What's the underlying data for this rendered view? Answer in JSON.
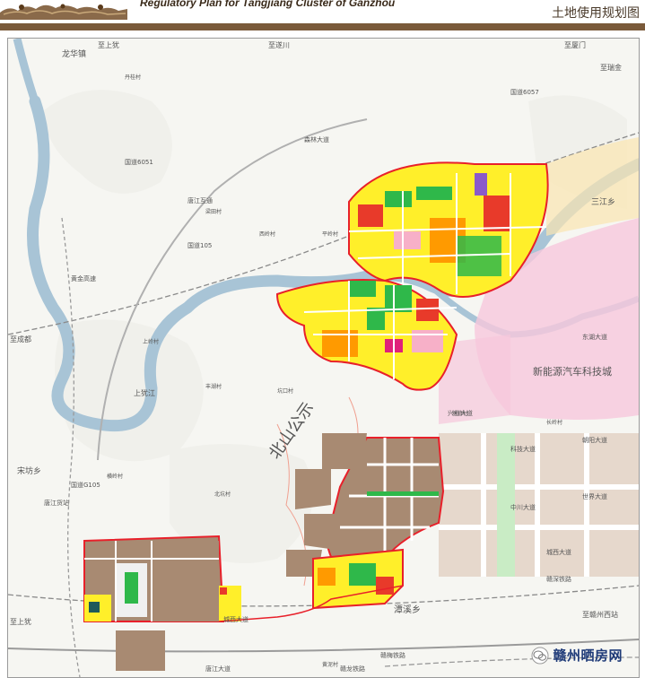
{
  "header": {
    "title_en": "Regulatory Plan for Tangjiang Cluster of Ganzhou",
    "title_cn": "土地使用规划图"
  },
  "colors": {
    "header_band": "#7a5a3a",
    "plan_boundary": "#e8202a",
    "river": "#a8c4d6",
    "residential": "#ffef2a",
    "commercial": "#e83a2a",
    "green": "#2fb84a",
    "industrial": "#a88a72",
    "public": "#ff9a00",
    "logistics": "#8a5aca",
    "pink_zone": "#f7c8dc"
  },
  "map": {
    "places": {
      "longhua": "龙华镇",
      "zhishang_you": "至上犹",
      "zhi_xiamen": "至厦门",
      "zhi_ruijin": "至瑞金",
      "zhi_suichuan": "至遂川",
      "sanjiang": "三江乡",
      "zhi_chengzhen": "至成都",
      "songfang": "宋坊乡",
      "tangjiang_station": "唐江货站",
      "new_energy": "新能源汽车科技城",
      "beishan": "北山公示",
      "tanxi": "潭溪乡",
      "zhi_ganzhou_west": "至赣州西站",
      "zhishang_you_bottom": "至上犹",
      "shangjiang": "上犹江",
      "tangjiang_interchange": "唐江互通"
    },
    "roads": {
      "g6051": "国道6051",
      "g105": "国道105",
      "g105_2": "国道G105",
      "g6057": "国道6057",
      "shijie_ave": "世界大道",
      "chenxi_ave": "城西大道",
      "tangjiang_ave": "唐江大道",
      "zhongchuan_ave": "中川大道",
      "ganmei_rail": "赣梅铁路",
      "chengxi_huojie": "城西大道",
      "dongxiang": "东湖大道",
      "keji_ave": "科技大道",
      "xingye_ave": "兴业大道",
      "senlin_rd": "森林大道",
      "chao_ave": "朝阳大道",
      "huangjin_rd": "黄金高速",
      "gande_rail": "赣龙铁路",
      "new_rail": "赣深铁路"
    },
    "villages": {
      "v1": "丹桂村",
      "v2": "梁田村",
      "v3": "西岭村",
      "v4": "平岭村",
      "v5": "上岭村",
      "v6": "丰湖村",
      "v7": "北坑村",
      "v8": "横岭村",
      "v9": "长岭村",
      "v10": "塘背村",
      "v11": "黄泥村",
      "v12": "坑口村"
    }
  },
  "watermark": {
    "text": "赣州晒房网"
  }
}
